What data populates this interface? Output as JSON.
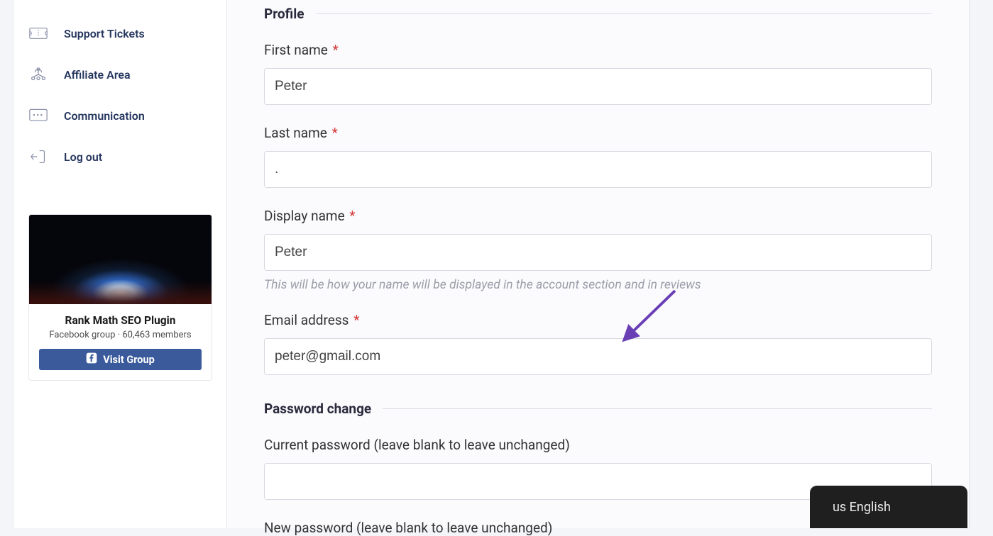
{
  "sidebar": {
    "items": [
      {
        "label": "Support Tickets",
        "icon": "ticket-icon"
      },
      {
        "label": "Affiliate Area",
        "icon": "network-icon"
      },
      {
        "label": "Communication",
        "icon": "chat-icon"
      },
      {
        "label": "Log out",
        "icon": "logout-icon"
      }
    ],
    "promo": {
      "title": "Rank Math SEO Plugin",
      "subtitle": "Facebook group · 60,463 members",
      "button_label": "Visit Group"
    }
  },
  "profile": {
    "section_title": "Profile",
    "first_name_label": "First name",
    "first_name_value": "Peter",
    "last_name_label": "Last name",
    "last_name_value": ".",
    "display_name_label": "Display name",
    "display_name_value": "Peter",
    "display_name_hint": "This will be how your name will be displayed in the account section and in reviews",
    "email_label": "Email address",
    "email_value": "peter@gmail.com"
  },
  "password": {
    "section_title": "Password change",
    "current_label": "Current password (leave blank to leave unchanged)",
    "current_value": "",
    "new_label": "New password (leave blank to leave unchanged)"
  },
  "language_widget": {
    "label": "us English"
  },
  "required_marker": "*",
  "colors": {
    "accent": "#3a5a9b",
    "arrow": "#6a3fb5",
    "required": "#d53636"
  }
}
